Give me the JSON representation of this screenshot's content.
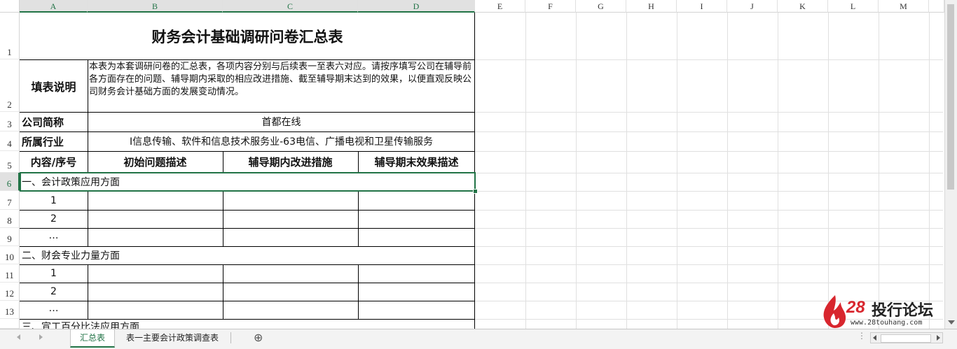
{
  "columns": [
    "A",
    "B",
    "C",
    "D",
    "E",
    "F",
    "G",
    "H",
    "I",
    "J",
    "K",
    "L",
    "M"
  ],
  "rows": [
    "1",
    "2",
    "3",
    "4",
    "5",
    "6",
    "7",
    "8",
    "9",
    "10",
    "11",
    "12",
    "13"
  ],
  "title": "财务会计基础调研问卷汇总表",
  "instructions_label": "填表说明",
  "instructions_text": "本表为本套调研问卷的汇总表，各项内容分别与后续表一至表六对应。请按序填写公司在辅导前各方面存在的问题、辅导期内采取的相应改进措施、截至辅导期末达到的效果，以便直观反映公司财务会计基础方面的发展变动情况。",
  "company_label": "公司简称",
  "company_value": "首都在线",
  "industry_label": "所属行业",
  "industry_value": "I信息传输、软件和信息技术服务业-63电信、广播电视和卫星传输服务",
  "headers": [
    "内容/序号",
    "初始问题描述",
    "辅导期内改进措施",
    "辅导期末效果描述"
  ],
  "section1": "一、会计政策应用方面",
  "section2": "二、财会专业力量方面",
  "section3": "三、宣工百分比法应用方面",
  "idx": [
    "1",
    "2",
    "…"
  ],
  "tabs": [
    "汇总表",
    "表一主要会计政策调查表"
  ],
  "add_sheet": "⊕",
  "watermark": {
    "name": "投行论坛",
    "num": "28",
    "url": "www.28touhang.com"
  },
  "colors": {
    "accent": "#217346",
    "brand": "#d8262e"
  }
}
